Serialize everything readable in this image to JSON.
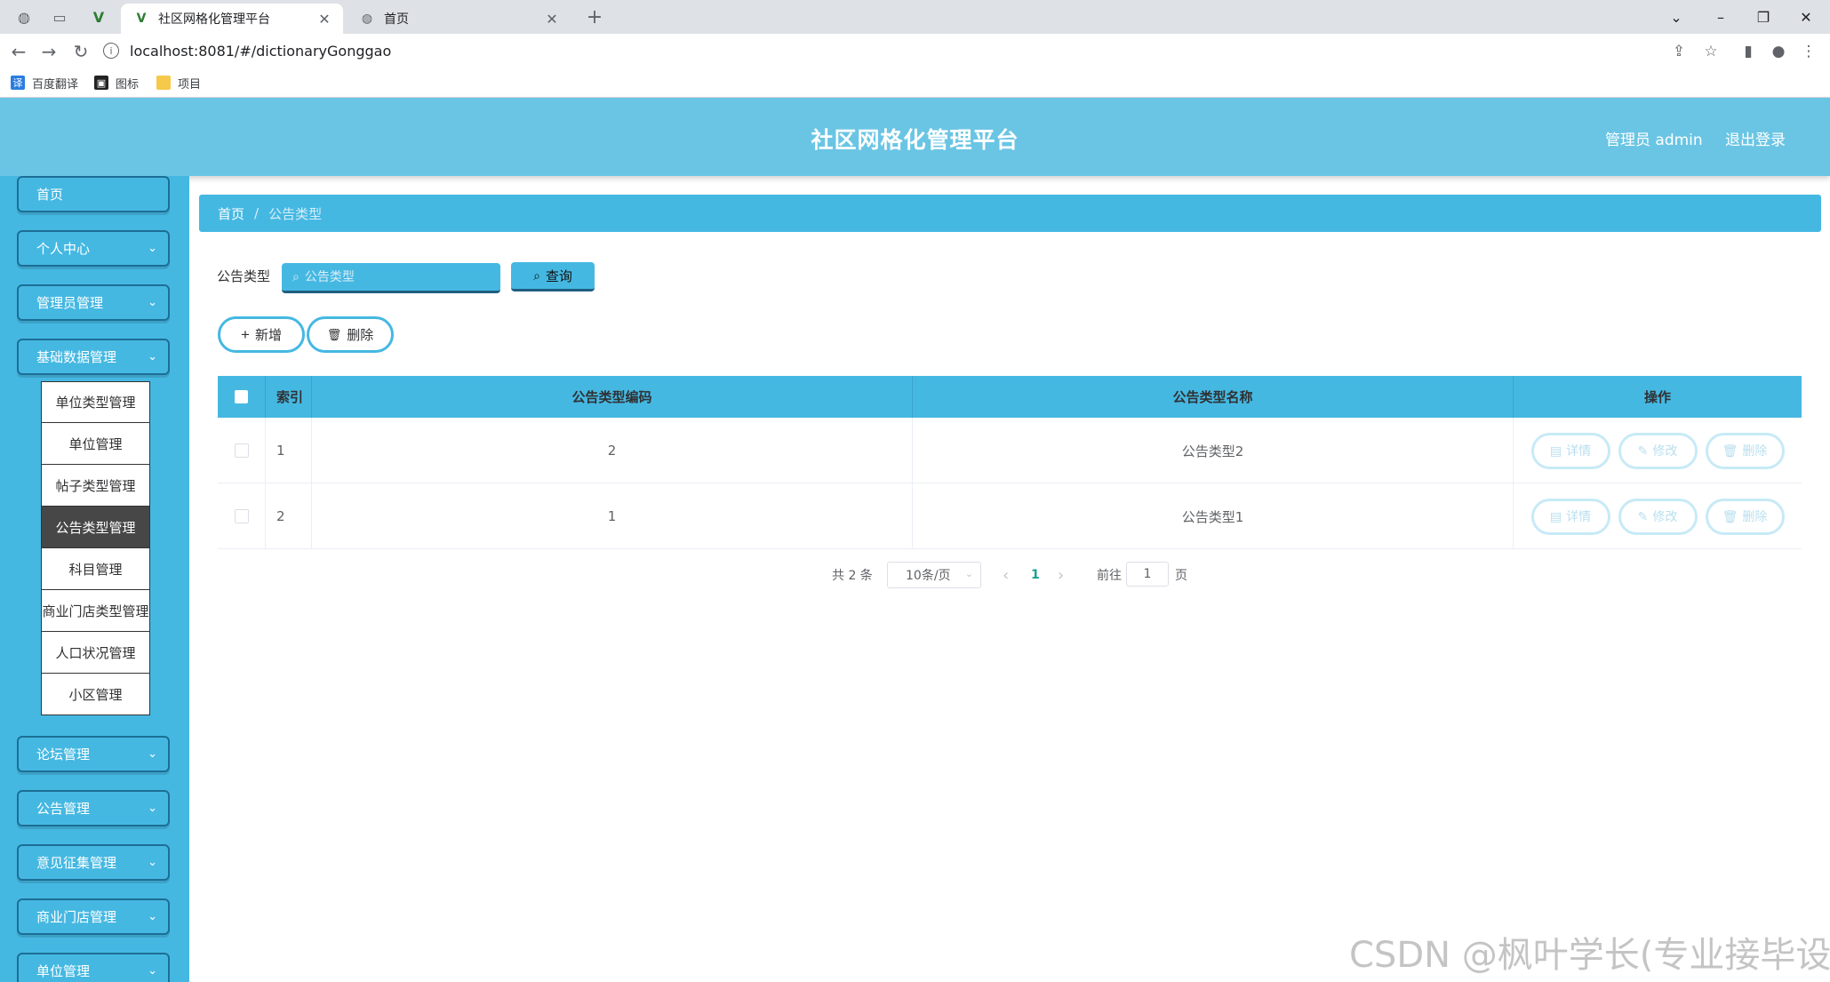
{
  "browser": {
    "tabs": [
      {
        "title": "社区网格化管理平台",
        "active": true
      },
      {
        "title": "首页",
        "active": false
      }
    ],
    "new_tab_label": "+",
    "address": "localhost:8081/#/dictionaryGonggao",
    "bookmarks": [
      {
        "label": "百度翻译",
        "icon": "translate-icon"
      },
      {
        "label": "图标",
        "icon": "image-icon"
      },
      {
        "label": "项目",
        "icon": "folder-icon"
      }
    ]
  },
  "header": {
    "title": "社区网格化管理平台",
    "user_label": "管理员 admin",
    "logout_label": "退出登录",
    "color": "#6ac5e4"
  },
  "sidebar": {
    "top_items": [
      {
        "label": "首页",
        "expandable": false
      },
      {
        "label": "个人中心",
        "expandable": true
      },
      {
        "label": "管理员管理",
        "expandable": true
      },
      {
        "label": "基础数据管理",
        "expandable": true
      }
    ],
    "submenu": [
      {
        "label": "单位类型管理",
        "active": false
      },
      {
        "label": "单位管理",
        "active": false
      },
      {
        "label": "帖子类型管理",
        "active": false
      },
      {
        "label": "公告类型管理",
        "active": true
      },
      {
        "label": "科目管理",
        "active": false
      },
      {
        "label": "商业门店类型管理",
        "active": false
      },
      {
        "label": "人口状况管理",
        "active": false
      },
      {
        "label": "小区管理",
        "active": false
      }
    ],
    "bottom_items": [
      {
        "label": "论坛管理"
      },
      {
        "label": "公告管理"
      },
      {
        "label": "意见征集管理"
      },
      {
        "label": "商业门店管理"
      },
      {
        "label": "单位管理"
      }
    ],
    "color": "#45b8e2"
  },
  "breadcrumb": {
    "home": "首页",
    "separator": "/",
    "current": "公告类型"
  },
  "search": {
    "label": "公告类型",
    "placeholder": "公告类型",
    "button_label": "查询"
  },
  "actions": {
    "add_label": "新增",
    "delete_label": "删除"
  },
  "table": {
    "headers": {
      "index": "索引",
      "code": "公告类型编码",
      "name": "公告类型名称",
      "ops": "操作"
    },
    "rows": [
      {
        "index": "1",
        "code": "2",
        "name": "公告类型2"
      },
      {
        "index": "2",
        "code": "1",
        "name": "公告类型1"
      }
    ],
    "row_actions": {
      "detail": "详情",
      "edit": "修改",
      "delete": "删除"
    }
  },
  "pagination": {
    "total": "共 2 条",
    "page_size": "10条/页",
    "prev": "‹",
    "current_page": "1",
    "next": "›",
    "goto_prefix": "前往",
    "goto_value": "1",
    "goto_suffix": "页"
  },
  "watermark": "CSDN @枫叶学长(专业接毕设)"
}
